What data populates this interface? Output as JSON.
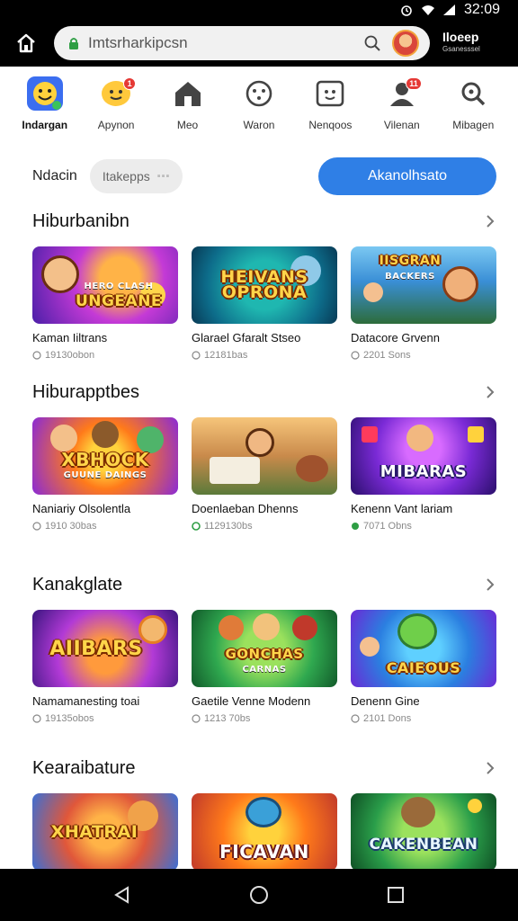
{
  "status_bar": {
    "time": "32:09"
  },
  "browser": {
    "url": "Imtsrharkipcsn",
    "brand": "Iloeep",
    "brand_sub": "Gsanesssel"
  },
  "categories": [
    {
      "label": "Indargan",
      "icon": "smiley-app-icon",
      "badge": ""
    },
    {
      "label": "Apynon",
      "icon": "chat-face-icon",
      "badge": "1"
    },
    {
      "label": "Meo",
      "icon": "house-icon",
      "badge": ""
    },
    {
      "label": "Waron",
      "icon": "dial-icon",
      "badge": ""
    },
    {
      "label": "Nenqoos",
      "icon": "window-face-icon",
      "badge": ""
    },
    {
      "label": "Vilenan",
      "icon": "user-icon",
      "badge": "11"
    },
    {
      "label": "Mibagen",
      "icon": "search-icon",
      "badge": ""
    }
  ],
  "filter": {
    "label": "Ndacin",
    "chip": "Itakepps",
    "button": "Akanolhsato"
  },
  "sections": [
    {
      "title": "Hiburbanibn",
      "tiles": [
        {
          "art_title": "UNGEANE",
          "art_sub": "HERO CLASH",
          "title": "Kaman Iiltrans",
          "meta": "19130obon"
        },
        {
          "art_title": "HEIVANS OPRONA",
          "art_sub": "",
          "title": "Glarael Gfaralt Stseo",
          "meta": "12181bas"
        },
        {
          "art_title": "IISGRAN",
          "art_sub": "BACKERS",
          "title": "Datacore Grvenn",
          "meta": "2201 Sons"
        }
      ]
    },
    {
      "title": "Hiburapptbes",
      "tiles": [
        {
          "art_title": "XBHOCK",
          "art_sub": "GUUNE DAINGS",
          "title": "Naniariy Olsolentla",
          "meta": "1910 30bas"
        },
        {
          "art_title": "",
          "art_sub": "",
          "title": "Doenlaeban Dhenns",
          "meta": "1129130bs"
        },
        {
          "art_title": "MIBARAS",
          "art_sub": "",
          "title": "Kenenn Vant lariam",
          "meta": "7071 Obns"
        }
      ]
    },
    {
      "title": "Kanakglate",
      "tiles": [
        {
          "art_title": "AIIBARS",
          "art_sub": "",
          "title": "Namamanesting toai",
          "meta": "19135obos"
        },
        {
          "art_title": "GONCHAS",
          "art_sub": "CARNAS",
          "title": "Gaetile Venne Modenn",
          "meta": "1213 70bs"
        },
        {
          "art_title": "CAIEOUS",
          "art_sub": "",
          "title": "Denenn Gine",
          "meta": "2101 Dons"
        }
      ]
    },
    {
      "title": "Kearaibature",
      "tiles": [
        {
          "art_title": "XHATRAI",
          "art_sub": "",
          "title": "",
          "meta": ""
        },
        {
          "art_title": "FICAVAN",
          "art_sub": "",
          "title": "",
          "meta": ""
        },
        {
          "art_title": "CAKENBEAN",
          "art_sub": "",
          "title": "",
          "meta": ""
        }
      ]
    }
  ],
  "colors": {
    "primary": "#2f7fe6",
    "badge": "#e53935"
  }
}
